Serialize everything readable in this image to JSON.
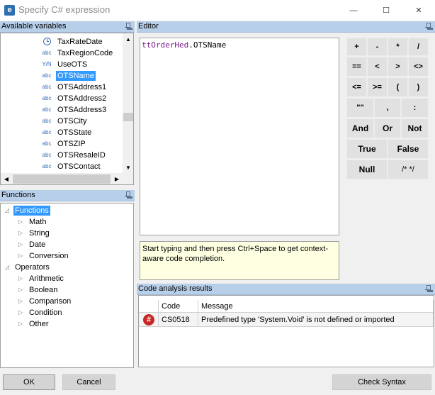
{
  "window": {
    "title": "Specify C# expression",
    "app_icon_letter": "e",
    "minimize_glyph": "—",
    "maximize_glyph": "☐",
    "close_glyph": "✕"
  },
  "variables_panel": {
    "title": "Available variables",
    "items": [
      {
        "type": "clock-icon",
        "name": "TaxRateDate"
      },
      {
        "type": "abc",
        "name": "TaxRegionCode"
      },
      {
        "type": "Y/N",
        "name": "UseOTS"
      },
      {
        "type": "abc",
        "name": "OTSName",
        "selected": true
      },
      {
        "type": "abc",
        "name": "OTSAddress1"
      },
      {
        "type": "abc",
        "name": "OTSAddress2"
      },
      {
        "type": "abc",
        "name": "OTSAddress3"
      },
      {
        "type": "abc",
        "name": "OTSCity"
      },
      {
        "type": "abc",
        "name": "OTSState"
      },
      {
        "type": "abc",
        "name": "OTSZIP"
      },
      {
        "type": "abc",
        "name": "OTSResaleID"
      },
      {
        "type": "abc",
        "name": "OTSContact"
      }
    ]
  },
  "functions_panel": {
    "title": "Functions",
    "tree": [
      {
        "label": "Functions",
        "level": 0,
        "expanded": true,
        "selected": true
      },
      {
        "label": "Math",
        "level": 1
      },
      {
        "label": "String",
        "level": 1
      },
      {
        "label": "Date",
        "level": 1
      },
      {
        "label": "Conversion",
        "level": 1
      },
      {
        "label": "Operators",
        "level": 0,
        "expanded": true
      },
      {
        "label": "Arithmetic",
        "level": 1
      },
      {
        "label": "Boolean",
        "level": 1
      },
      {
        "label": "Comparison",
        "level": 1
      },
      {
        "label": "Condition",
        "level": 1
      },
      {
        "label": "Other",
        "level": 1
      }
    ]
  },
  "editor": {
    "title": "Editor",
    "code_object": "ttOrderHed",
    "code_member": ".OTSName",
    "hint": "Start typing and then press Ctrl+Space to get context-aware code completion."
  },
  "operators": {
    "row1": [
      "+",
      "-",
      "*",
      "/"
    ],
    "row2": [
      "==",
      "<",
      ">",
      "<>"
    ],
    "row3": [
      "<=",
      ">=",
      "(",
      ")"
    ],
    "row4": [
      "\"\"",
      ",",
      ":"
    ],
    "row5": [
      "And",
      "Or",
      "Not"
    ],
    "row6": [
      "True",
      "False"
    ],
    "row7": [
      "Null",
      "/* */"
    ]
  },
  "analysis": {
    "title": "Code analysis results",
    "columns": {
      "code": "Code",
      "message": "Message"
    },
    "rows": [
      {
        "icon": "error-icon",
        "code": "CS0518",
        "message": "Predefined type 'System.Void' is not defined or imported"
      }
    ]
  },
  "buttons": {
    "ok": "OK",
    "cancel": "Cancel",
    "check_syntax": "Check Syntax"
  }
}
